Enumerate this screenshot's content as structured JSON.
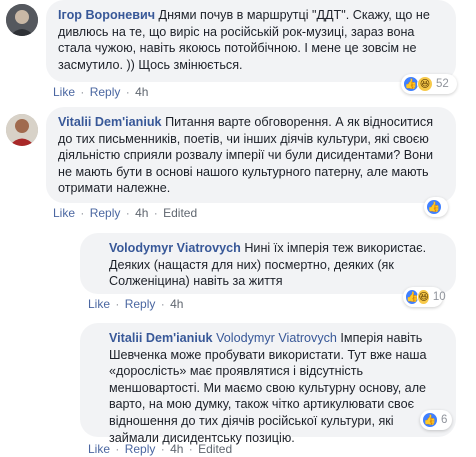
{
  "comments": [
    {
      "author": "Ігор Вороневич",
      "text": "Днями почув в маршрутці \"ДДТ\". Скажу, що не дивлюсь на те, що виріс на російській рок-музиці, зараз вона стала чужою, навіть якоюсь потойбічною. І мене це зовсім не засмутило. )) Щось змінюється.",
      "like": "Like",
      "reply": "Reply",
      "time": "4h",
      "reactions": [
        "like-icon",
        "haha-icon"
      ],
      "reaction_count": "52"
    },
    {
      "author": "Vitalii Dem'ianiuk",
      "text": "Питання варте обговорення. А як відноситися до тих письменників, поетів, чи інших діячів культури, які своєю діяльністю сприяли розвалу імперії чи були дисидентами? Вони не мають бути в основі нашого культурного патерну, але мають отримати належне.",
      "like": "Like",
      "reply": "Reply",
      "time": "4h",
      "edited": "Edited",
      "reactions": [
        "like-icon"
      ],
      "reaction_count": ""
    },
    {
      "author": "Volodymyr Viatrovych",
      "text": "Нині їх імперія теж використає. Деяких (нащастя для них) посмертно, деяких (як Солженіцина) навіть за життя",
      "like": "Like",
      "reply": "Reply",
      "time": "4h",
      "reactions": [
        "like-icon",
        "haha-icon"
      ],
      "reaction_count": "10"
    },
    {
      "author": "Vitalii Dem'ianiuk",
      "mention": "Volodymyr Viatrovych",
      "text": "Імперія навіть Шевченка може пробувати використати. Тут вже наша «дорослість» має проявлятися і відсутність меншовартості. Ми маємо свою культурну основу, але варто, на мою думку, також чітко артикулювати своє відношення до тих діячів російської культури, які займали дисидентську позицію.",
      "like": "Like",
      "reply": "Reply",
      "time": "4h",
      "edited": "Edited",
      "reactions": [
        "like-icon"
      ],
      "reaction_count": "6"
    }
  ],
  "separator": "·"
}
